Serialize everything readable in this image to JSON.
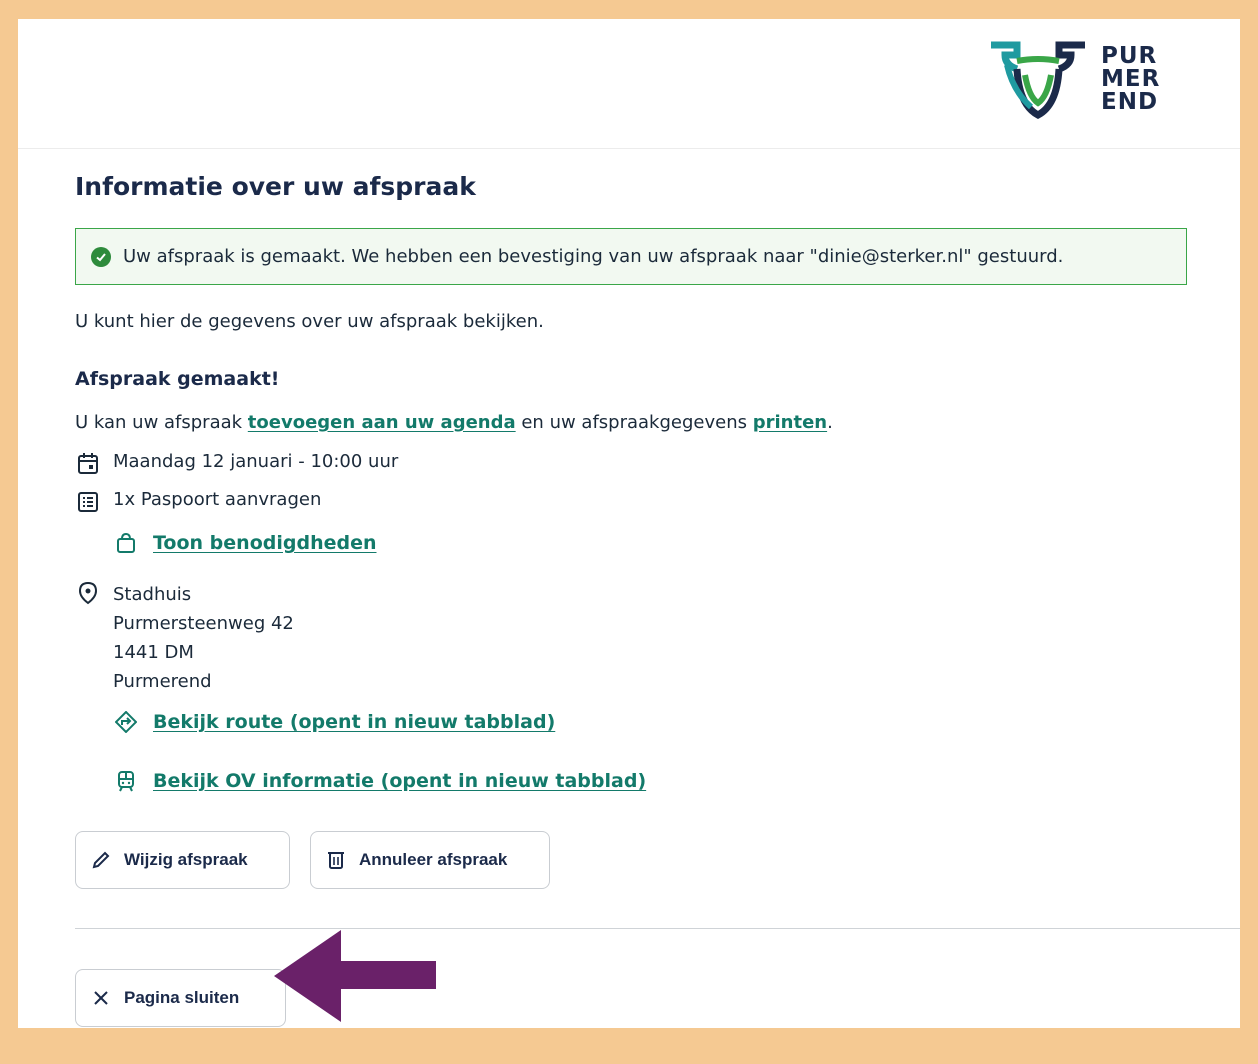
{
  "logo": {
    "line1": "PUR",
    "line2": "MER",
    "line3": "END"
  },
  "page": {
    "title": "Informatie over uw afspraak",
    "alert": "Uw afspraak is gemaakt. We hebben een bevestiging van uw afspraak naar \"dinie@sterker.nl\" gestuurd.",
    "intro": "U kunt hier de gegevens over uw afspraak bekijken.",
    "subtitle": "Afspraak gemaakt!",
    "links_line": {
      "prefix": "U kan uw afspraak ",
      "agenda_link": "toevoegen aan uw agenda",
      "middle": " en uw afspraakgegevens ",
      "print_link": "printen",
      "suffix": "."
    },
    "date": "Maandag 12 januari - 10:00 uur",
    "product": "1x Paspoort aanvragen",
    "requirements_link": "Toon benodigdheden",
    "location": {
      "name": "Stadhuis",
      "street": "Purmersteenweg 42",
      "postcode": "1441 DM",
      "city": "Purmerend"
    },
    "route_link": "Bekijk route (opent in nieuw tabblad)",
    "ov_link": "Bekijk OV informatie (opent in nieuw tabblad)",
    "edit_button": "Wijzig afspraak",
    "cancel_button": "Annuleer afspraak",
    "close_button": "Pagina sluiten"
  },
  "colors": {
    "frame": "#f5c992",
    "link": "#137a6a",
    "success_border": "#3aa648",
    "arrow": "#6a2169"
  },
  "icons": {
    "alert": "check-circle-icon",
    "date": "calendar-icon",
    "product": "list-icon",
    "requirements": "bag-icon",
    "location": "map-pin-icon",
    "route": "route-icon",
    "ov": "train-icon",
    "edit": "pencil-icon",
    "cancel": "trash-icon",
    "close": "close-icon"
  }
}
